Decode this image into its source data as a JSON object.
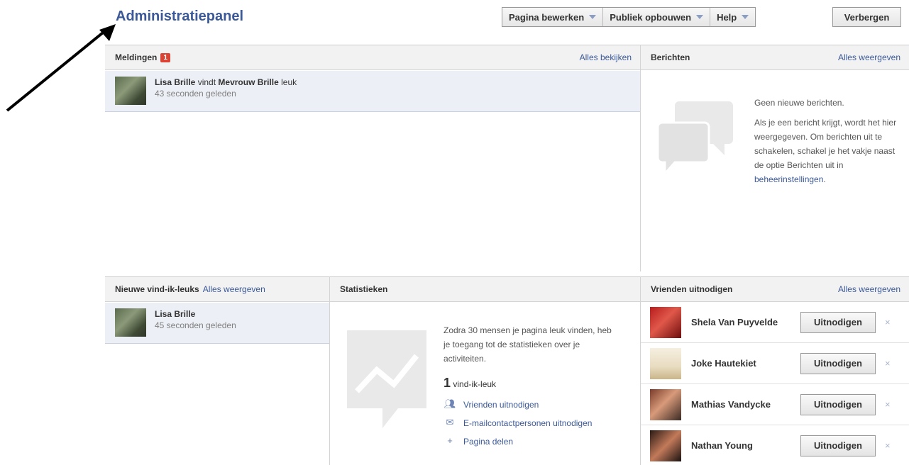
{
  "header": {
    "title": "Administratiepanel",
    "menu": [
      {
        "label": "Pagina bewerken"
      },
      {
        "label": "Publiek opbouwen"
      },
      {
        "label": "Help"
      }
    ],
    "hide_label": "Verbergen"
  },
  "meldingen": {
    "title": "Meldingen",
    "badge": "1",
    "link": "Alles bekijken",
    "item": {
      "actor": "Lisa Brille",
      "verb": "vindt",
      "object": "Mevrouw Brille",
      "suffix": "leuk",
      "time": "43 seconden geleden"
    }
  },
  "berichten": {
    "title": "Berichten",
    "link": "Alles weergeven",
    "empty_title": "Geen nieuwe berichten.",
    "body": "Als je een bericht krijgt, wordt het hier weergegeven. Om berichten uit te schakelen, schakel je het vakje naast de optie Berichten uit in",
    "settings_link": "beheerinstellingen",
    "period": "."
  },
  "likes": {
    "title": "Nieuwe vind-ik-leuks",
    "link": "Alles weergeven",
    "item": {
      "name": "Lisa Brille",
      "time": "45 seconden geleden"
    }
  },
  "stats": {
    "title": "Statistieken",
    "text": "Zodra 30 mensen je pagina leuk vinden, heb je toegang tot de statistieken over je activiteiten.",
    "count": "1",
    "count_label": "vind-ik-leuk",
    "links": [
      {
        "label": "Vrienden uitnodigen",
        "icon": "friends-icon"
      },
      {
        "label": "E-mailcontactpersonen uitnodigen",
        "icon": "email-contacts-icon"
      },
      {
        "label": "Pagina delen",
        "icon": "plus-icon"
      }
    ]
  },
  "invite": {
    "title": "Vrienden uitnodigen",
    "link": "Alles weergeven",
    "button_label": "Uitnodigen",
    "remove_glyph": "×",
    "friends": [
      {
        "name": "Shela Van Puyvelde"
      },
      {
        "name": "Joke Hautekiet"
      },
      {
        "name": "Mathias Vandycke"
      },
      {
        "name": "Nathan Young"
      }
    ]
  },
  "colors": {
    "brand_blue": "#3b5998",
    "badge_red": "#d94434",
    "highlight_row": "#eceff5"
  }
}
